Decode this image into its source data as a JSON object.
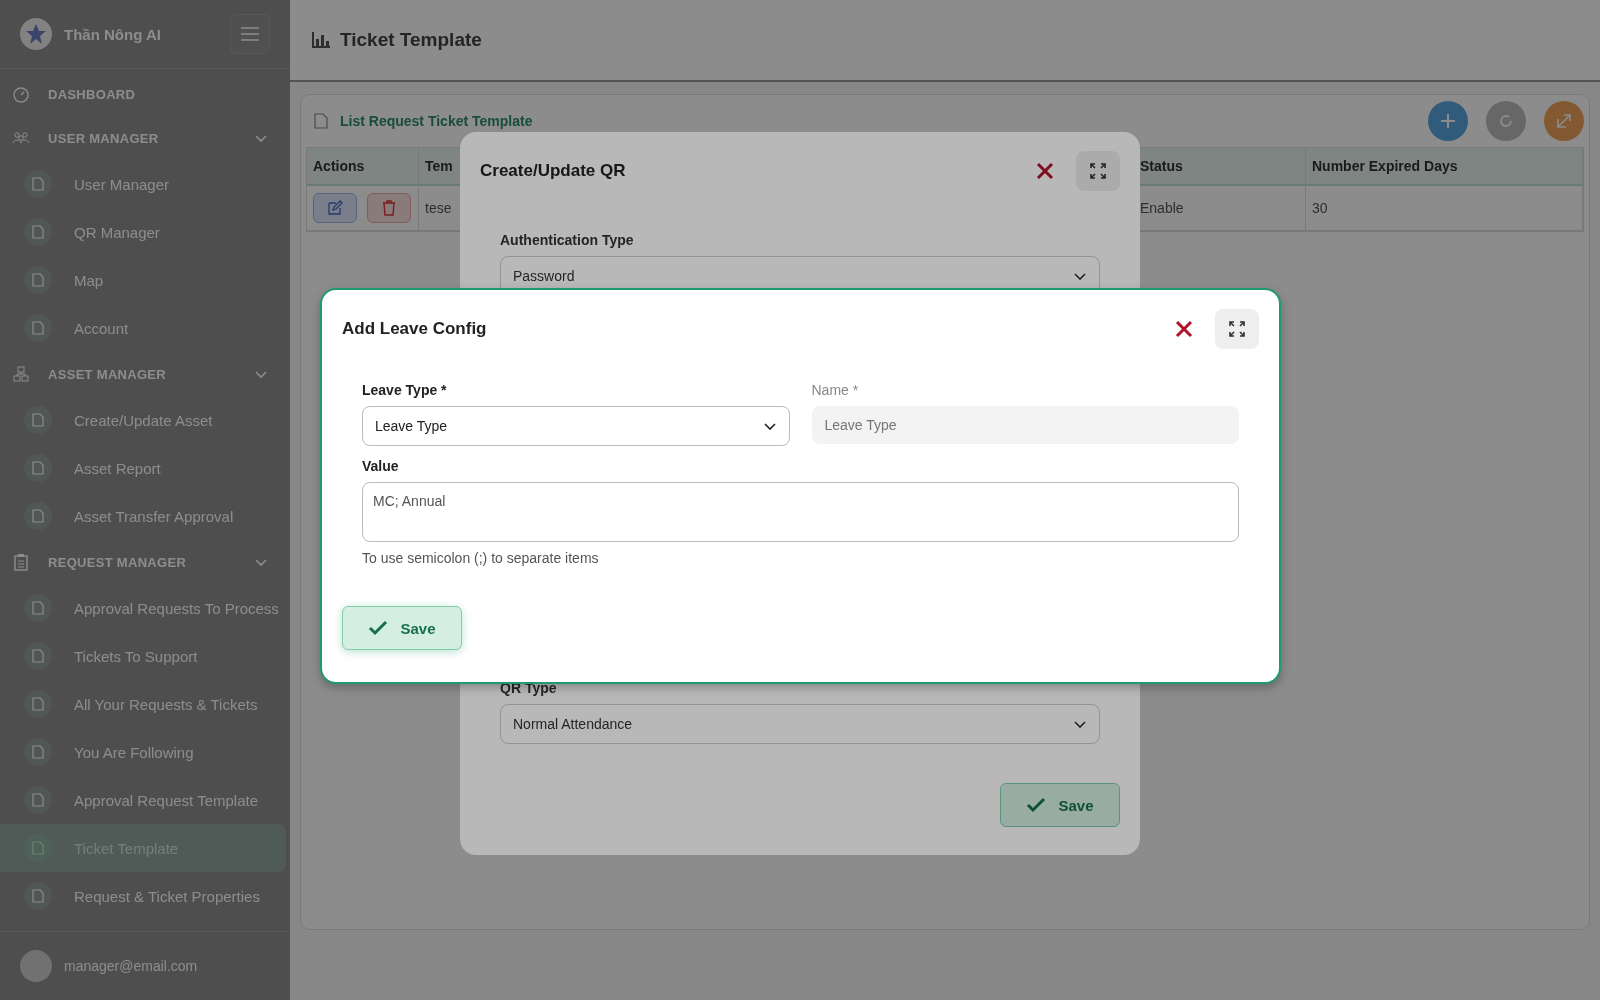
{
  "sidebar": {
    "brand": "Thần Nông AI",
    "sections": [
      {
        "kind": "link",
        "label": "DASHBOARD"
      },
      {
        "kind": "group",
        "label": "USER MANAGER",
        "expanded": true,
        "children": [
          {
            "label": "User Manager",
            "selected": false
          },
          {
            "label": "QR Manager",
            "selected": false
          },
          {
            "label": "Map",
            "selected": false
          },
          {
            "label": "Account",
            "selected": false
          }
        ]
      },
      {
        "kind": "group",
        "label": "ASSET MANAGER",
        "expanded": true,
        "children": [
          {
            "label": "Create/Update Asset",
            "selected": false
          },
          {
            "label": "Asset Report",
            "selected": false
          },
          {
            "label": "Asset Transfer Approval",
            "selected": false
          }
        ]
      },
      {
        "kind": "group",
        "label": "REQUEST MANAGER",
        "expanded": true,
        "children": [
          {
            "label": "Approval Requests To Process",
            "selected": false
          },
          {
            "label": "Tickets To Support",
            "selected": false
          },
          {
            "label": "All Your Requests & Tickets",
            "selected": false
          },
          {
            "label": "You Are Following",
            "selected": false
          },
          {
            "label": "Approval Request Template",
            "selected": false
          },
          {
            "label": "Ticket Template",
            "selected": true
          },
          {
            "label": "Request & Ticket Properties",
            "selected": false
          }
        ]
      }
    ],
    "user": "manager@email.com"
  },
  "header": {
    "title": "Ticket Template"
  },
  "panel": {
    "title": "List Request Ticket Template",
    "table": {
      "columns": [
        "Actions",
        "Tem",
        "Status",
        "Number Expired Days"
      ],
      "rows": [
        {
          "cells": [
            "",
            "tese",
            "Enable",
            "30"
          ]
        }
      ]
    }
  },
  "qr_dialog": {
    "title": "Create/Update QR",
    "fields": [
      {
        "label": "Authentication Type",
        "value": "Password"
      },
      {
        "label": "QR Type",
        "value": "Normal Attendance"
      }
    ],
    "save": "Save"
  },
  "leave_dialog": {
    "title": "Add Leave Config",
    "leave_type": {
      "label": "Leave Type *",
      "value": "Leave Type"
    },
    "name": {
      "label": "Name *",
      "placeholder": "Leave Type",
      "disabled": true
    },
    "value": {
      "label": "Value",
      "value": "MC; Annual"
    },
    "hint": "To use semicolon (;) to separate items",
    "save": "Save"
  }
}
